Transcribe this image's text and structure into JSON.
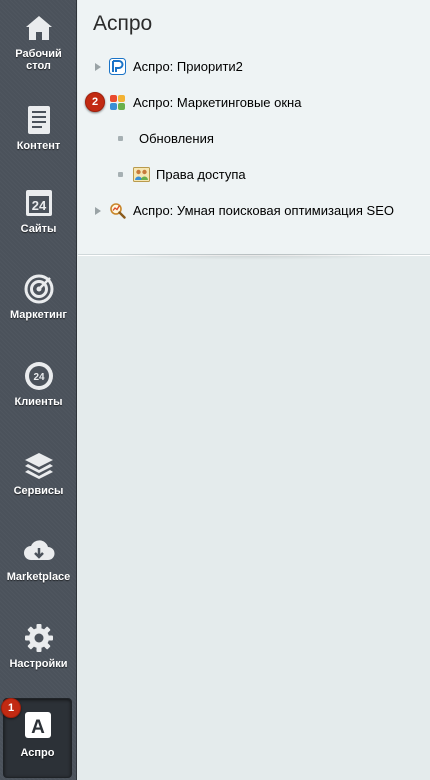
{
  "sidebar": {
    "items": [
      {
        "label": "Рабочий стол",
        "icon": "home-icon"
      },
      {
        "label": "Контент",
        "icon": "document-icon"
      },
      {
        "label": "Сайты",
        "icon": "calendar-24-icon"
      },
      {
        "label": "Маркетинг",
        "icon": "target-icon"
      },
      {
        "label": "Клиенты",
        "icon": "clients-24-icon"
      },
      {
        "label": "Сервисы",
        "icon": "layers-icon"
      },
      {
        "label": "Marketplace",
        "icon": "cloud-download-icon"
      },
      {
        "label": "Настройки",
        "icon": "gear-icon"
      },
      {
        "label": "Аспро",
        "icon": "aspro-a-icon",
        "badge": "1"
      }
    ]
  },
  "main": {
    "title": "Аспро",
    "tree": [
      {
        "label": "Аспро: Приорити2",
        "icon": "priority-logo-icon"
      },
      {
        "label": "Аспро: Маркетинговые окна",
        "icon": "marketing-windows-icon",
        "badge": "2"
      },
      {
        "label": "Обновления"
      },
      {
        "label": "Права доступа",
        "icon": "users-icon"
      },
      {
        "label": "Аспро: Умная поисковая оптимизация SEO",
        "icon": "seo-magnifier-icon"
      }
    ]
  },
  "colors": {
    "sidebar_bg": "#4b525b",
    "panel_bg": "#eef3f4",
    "badge": "#c22a12"
  }
}
